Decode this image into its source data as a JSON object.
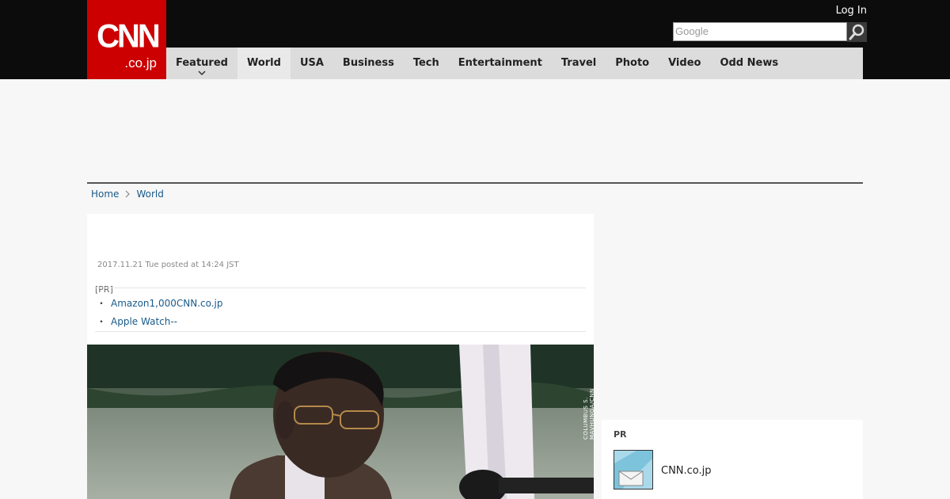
{
  "header": {
    "logo_main": "CNN",
    "logo_sub": ".co.jp",
    "login_label": "Log In",
    "search_placeholder": "Google"
  },
  "nav": {
    "items": [
      {
        "label": "Featured"
      },
      {
        "label": "World"
      },
      {
        "label": "USA"
      },
      {
        "label": "Business"
      },
      {
        "label": "Tech"
      },
      {
        "label": "Entertainment"
      },
      {
        "label": "Travel"
      },
      {
        "label": "Photo"
      },
      {
        "label": "Video"
      },
      {
        "label": "Odd News"
      }
    ]
  },
  "breadcrumb": {
    "home": "Home",
    "current": "World"
  },
  "article": {
    "date": "2017.11.21 Tue posted at 14:24 JST",
    "pr_label": "[PR]",
    "pr_links": [
      "Amazon1,000CNN.co.jp",
      "Apple Watch--"
    ],
    "photo_credit": "COLUMBUS S. MAVHUNGA/CNN"
  },
  "sidebar": {
    "pr_label": "PR",
    "item_title": "CNN.co.jp"
  },
  "colors": {
    "brand_red": "#cc0000",
    "topbar": "#0c0c0c",
    "nav_bg": "#dcdcdc",
    "link": "#1a5b8a"
  },
  "icons": [
    "search-icon",
    "chevron-down-icon",
    "chevron-right-icon"
  ]
}
